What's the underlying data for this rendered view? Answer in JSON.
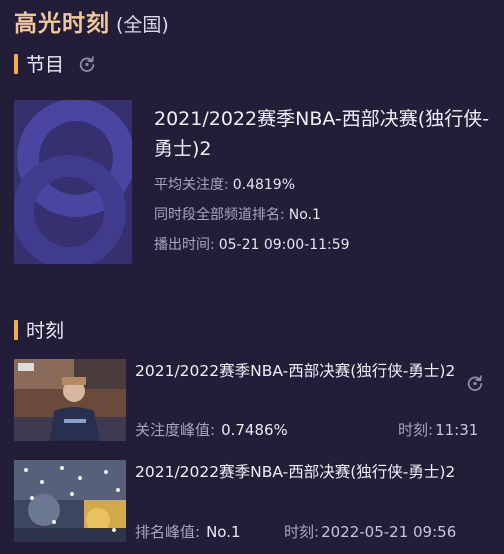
{
  "header": {
    "title": "高光时刻",
    "scope": "(全国)"
  },
  "program_section": {
    "label": "节目",
    "program": {
      "title": "2021/2022赛季NBA-西部决赛(独行侠-勇士)2",
      "avg_attention_label": "平均关注度:",
      "avg_attention_value": "0.4819%",
      "rank_label": "同时段全部频道排名:",
      "rank_value": "No.1",
      "air_time_label": "播出时间:",
      "air_time_value": "05-21 09:00-11:59"
    }
  },
  "moments_section": {
    "label": "时刻",
    "items": [
      {
        "title": "2021/2022赛季NBA-西部决赛(独行侠-勇士)2",
        "metric_label": "关注度峰值:",
        "metric_value": "0.7486%",
        "time_label": "时刻:",
        "time_value": "11:31"
      },
      {
        "title": "2021/2022赛季NBA-西部决赛(独行侠-勇士)2",
        "metric_label": "排名峰值:",
        "metric_value": "No.1",
        "time_label": "时刻:",
        "time_value": "2022-05-21 09:56"
      }
    ]
  },
  "colors": {
    "accent": "#f0b04c",
    "title": "#f0c99a",
    "background": "#231d38"
  }
}
